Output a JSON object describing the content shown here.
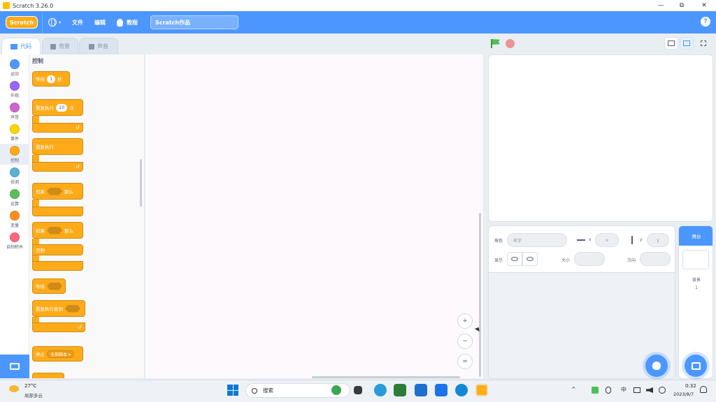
{
  "window": {
    "title": "Scratch 3.26.0",
    "minimize": "—",
    "maximize": "⧉",
    "close": "✕"
  },
  "menubar": {
    "logo": "Scratch",
    "language_caret": "▾",
    "file": "文件",
    "edit": "编辑",
    "tutorials": "教程",
    "project_title": "Scratch作品",
    "help": "?"
  },
  "tabs": {
    "code": "代码",
    "costumes": "背景",
    "sounds": "声音"
  },
  "categories": [
    {
      "label": "运动",
      "color": "#4c97ff"
    },
    {
      "label": "外观",
      "color": "#9966ff"
    },
    {
      "label": "声音",
      "color": "#cf63cf"
    },
    {
      "label": "事件",
      "color": "#ffd500"
    },
    {
      "label": "控制",
      "color": "#ffab19"
    },
    {
      "label": "侦测",
      "color": "#5cb1d6"
    },
    {
      "label": "运算",
      "color": "#59c059"
    },
    {
      "label": "变量",
      "color": "#ff8c1a"
    },
    {
      "label": "自制积木",
      "color": "#ff6680"
    }
  ],
  "palette": {
    "title": "控制",
    "wait": {
      "label": "等待",
      "value": "1",
      "unit": "秒"
    },
    "repeat": {
      "label": "重复执行",
      "value": "10",
      "unit": "次",
      "loop_arrow": "↺"
    },
    "forever": {
      "label": "重复执行",
      "loop_arrow": "↺"
    },
    "if_then": {
      "label": "如果",
      "then": "那么"
    },
    "if_else": {
      "label": "如果",
      "then": "那么",
      "else": "否则"
    },
    "wait_until": {
      "label": "等待"
    },
    "repeat_until": {
      "label": "重复执行直到",
      "loop_arrow": "↺"
    },
    "stop": {
      "label": "停止",
      "option": "全部脚本 ▾"
    }
  },
  "zoom": {
    "zoom_in": "+",
    "zoom_out": "−",
    "reset": "="
  },
  "sprite_info": {
    "sprite_label": "角色",
    "sprite_name": "名字",
    "x_label": "x",
    "x_value": "x",
    "y_label": "y",
    "y_value": "y",
    "show_label": "显示",
    "size_label": "大小",
    "direction_label": "方向"
  },
  "stage_pane": {
    "header": "舞台",
    "backdrops_label": "背景",
    "backdrops_count": "1"
  },
  "taskbar": {
    "temperature": "27°C",
    "weather": "局部多云",
    "search": "搜索",
    "ime": "中",
    "time": "0:32",
    "date": "2023/8/7"
  }
}
